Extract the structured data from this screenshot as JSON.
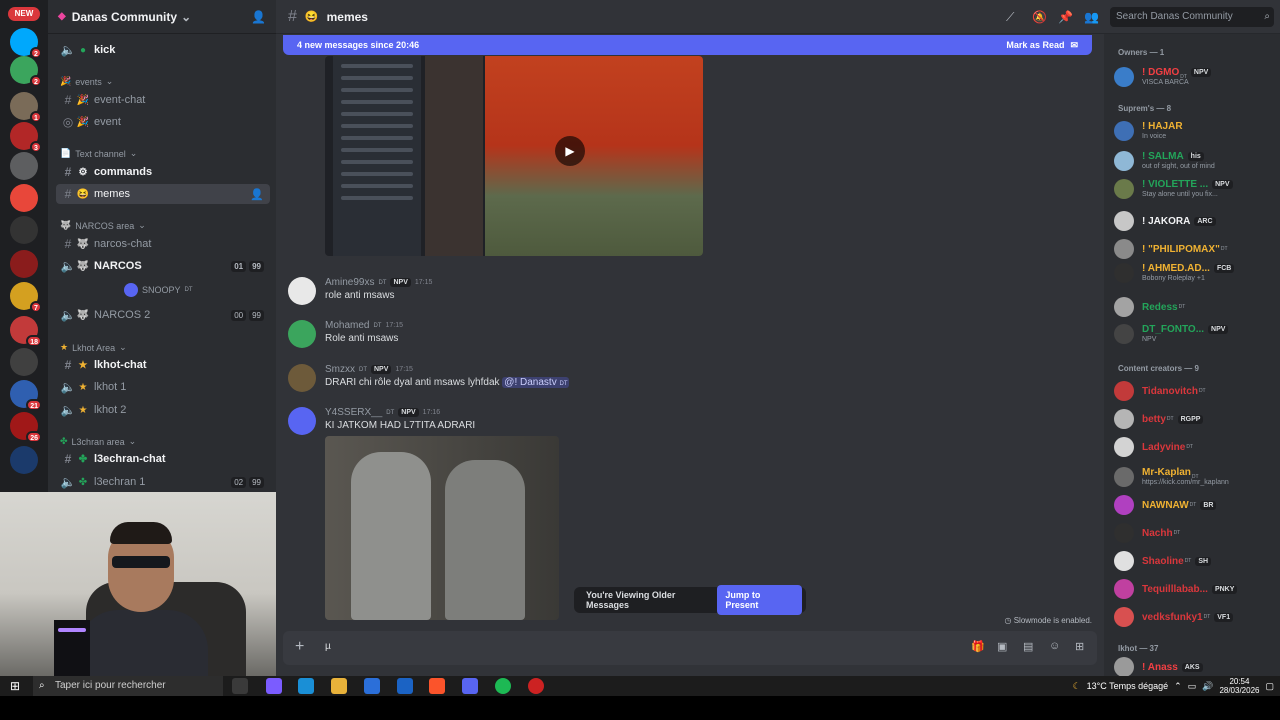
{
  "server": {
    "name": "Danas Community",
    "new_badge": "NEW"
  },
  "rail_badges": [
    "2",
    "2",
    "1",
    "3",
    "18",
    "21",
    "26",
    "7"
  ],
  "channels": {
    "kick": "kick",
    "events_cat": "events",
    "event_chat": "event-chat",
    "event": "event",
    "text_cat": "Text channel",
    "commands": "commands",
    "memes": "memes",
    "narcos_cat": "NARCOS area",
    "narcos_chat": "narcos-chat",
    "narcos": "NARCOS",
    "narcos_count_a": "01",
    "narcos_count_b": "99",
    "snoopy": "SNOOPY",
    "snoopy_tag": "DT",
    "narcos2": "NARCOS 2",
    "narcos2_count_a": "00",
    "narcos2_count_b": "99",
    "lkhot_cat": "Lkhot Area",
    "lkhot_chat": "lkhot-chat",
    "lkhot1": "lkhot 1",
    "lkhot2": "lkhot 2",
    "l3chran_cat": "L3chran area",
    "l3chran_chat": "l3echran-chat",
    "l3chran1": "l3echran 1",
    "l3chran1_count_a": "02",
    "l3chran1_count_b": "99"
  },
  "topbar": {
    "channel": "memes",
    "search_placeholder": "Search Danas Community"
  },
  "new_messages": {
    "text": "4 new messages since 20:46",
    "action": "Mark as Read"
  },
  "messages": [
    {
      "user": "Amine99xs",
      "dt": "DT",
      "tag": "NPV",
      "time": "17:15",
      "text": "role anti msaws"
    },
    {
      "user": "Mohamed",
      "dt": "DT",
      "tag": "",
      "time": "17:15",
      "text": "Role anti msaws"
    },
    {
      "user": "Smzxx",
      "dt": "DT",
      "tag": "NPV",
      "time": "17:15",
      "text": "DRARI chi rôle dyal anti msaws lyhfdak",
      "mention": "@! Danastv",
      "mention_dt": "DT"
    },
    {
      "user": "Y4SSERX__",
      "dt": "DT",
      "tag": "NPV",
      "time": "17:16",
      "text": "KI JATKOM HAD L7TITA ADRARI"
    }
  ],
  "older_bar": {
    "text": "You're Viewing Older Messages",
    "jump": "Jump to Present"
  },
  "slowmode": "Slowmode is enabled.",
  "composer": {
    "value": "µ"
  },
  "members": {
    "owners_header": "Owners — 1",
    "supremes_header": "Suprem's — 8",
    "creators_header": "Content creators — 9",
    "lkhot_header": "lkhot — 37",
    "list": [
      {
        "name": "! DGMO",
        "dt": "DT",
        "tag": "NPV",
        "status": "VISCA BARCA",
        "color": "#f23f43"
      },
      {
        "name": "! HAJAR",
        "dt": "",
        "tag": "",
        "status": "In voice",
        "color": "#f0b232"
      },
      {
        "name": "! SALMA",
        "dt": "",
        "tag": "his",
        "status": "out of sight, out of mind",
        "color": "#23a55a"
      },
      {
        "name": "! VIOLETTE ...",
        "dt": "",
        "tag": "NPV",
        "status": "Stay alone until you fix...",
        "color": "#23a55a"
      },
      {
        "name": "! JAKORA",
        "dt": "",
        "tag": "ARC",
        "status": "",
        "color": "#f2f3f5"
      },
      {
        "name": "! \"PHILIPOMAX\"",
        "dt": "DT",
        "tag": "",
        "status": "",
        "color": "#f0b232"
      },
      {
        "name": "! AHMED.AD...",
        "dt": "",
        "tag": "FCB",
        "status": "Bobony Roleplay +1",
        "color": "#f0b232"
      },
      {
        "name": "Redess",
        "dt": "DT",
        "tag": "",
        "status": "",
        "color": "#23a55a"
      },
      {
        "name": "DT_FONTO...",
        "dt": "",
        "tag": "NPV",
        "status": "NPV",
        "color": "#23a55a"
      },
      {
        "name": "Tidanovitch",
        "dt": "DT",
        "tag": "",
        "status": "",
        "color": "#da373c"
      },
      {
        "name": "betty",
        "dt": "DT",
        "tag": "RGPP",
        "status": "",
        "color": "#da373c"
      },
      {
        "name": "Ladyvine",
        "dt": "DT",
        "tag": "",
        "status": "",
        "color": "#da373c"
      },
      {
        "name": "Mr-Kaplan",
        "dt": "DT",
        "tag": "",
        "status": "https://kick.com/mr_kaplann",
        "color": "#f0b232"
      },
      {
        "name": "NAWNAW",
        "dt": "DT",
        "tag": "BR",
        "status": "",
        "color": "#f0b232"
      },
      {
        "name": "Nachh",
        "dt": "DT",
        "tag": "",
        "status": "",
        "color": "#da373c"
      },
      {
        "name": "Shaoline",
        "dt": "DT",
        "tag": "SH",
        "status": "",
        "color": "#da373c"
      },
      {
        "name": "Tequilllabab...",
        "dt": "",
        "tag": "PNKY",
        "status": "",
        "color": "#da373c"
      },
      {
        "name": "vedksfunky1",
        "dt": "DT",
        "tag": "VF1",
        "status": "",
        "color": "#da373c"
      },
      {
        "name": "! Anass",
        "dt": "",
        "tag": "AKS",
        "status": "",
        "color": "#f23f43"
      }
    ]
  },
  "taskbar": {
    "search": "Taper ici pour rechercher",
    "weather": "13°C  Temps dégagé",
    "time": "20:54",
    "date": "28/03/2026"
  }
}
